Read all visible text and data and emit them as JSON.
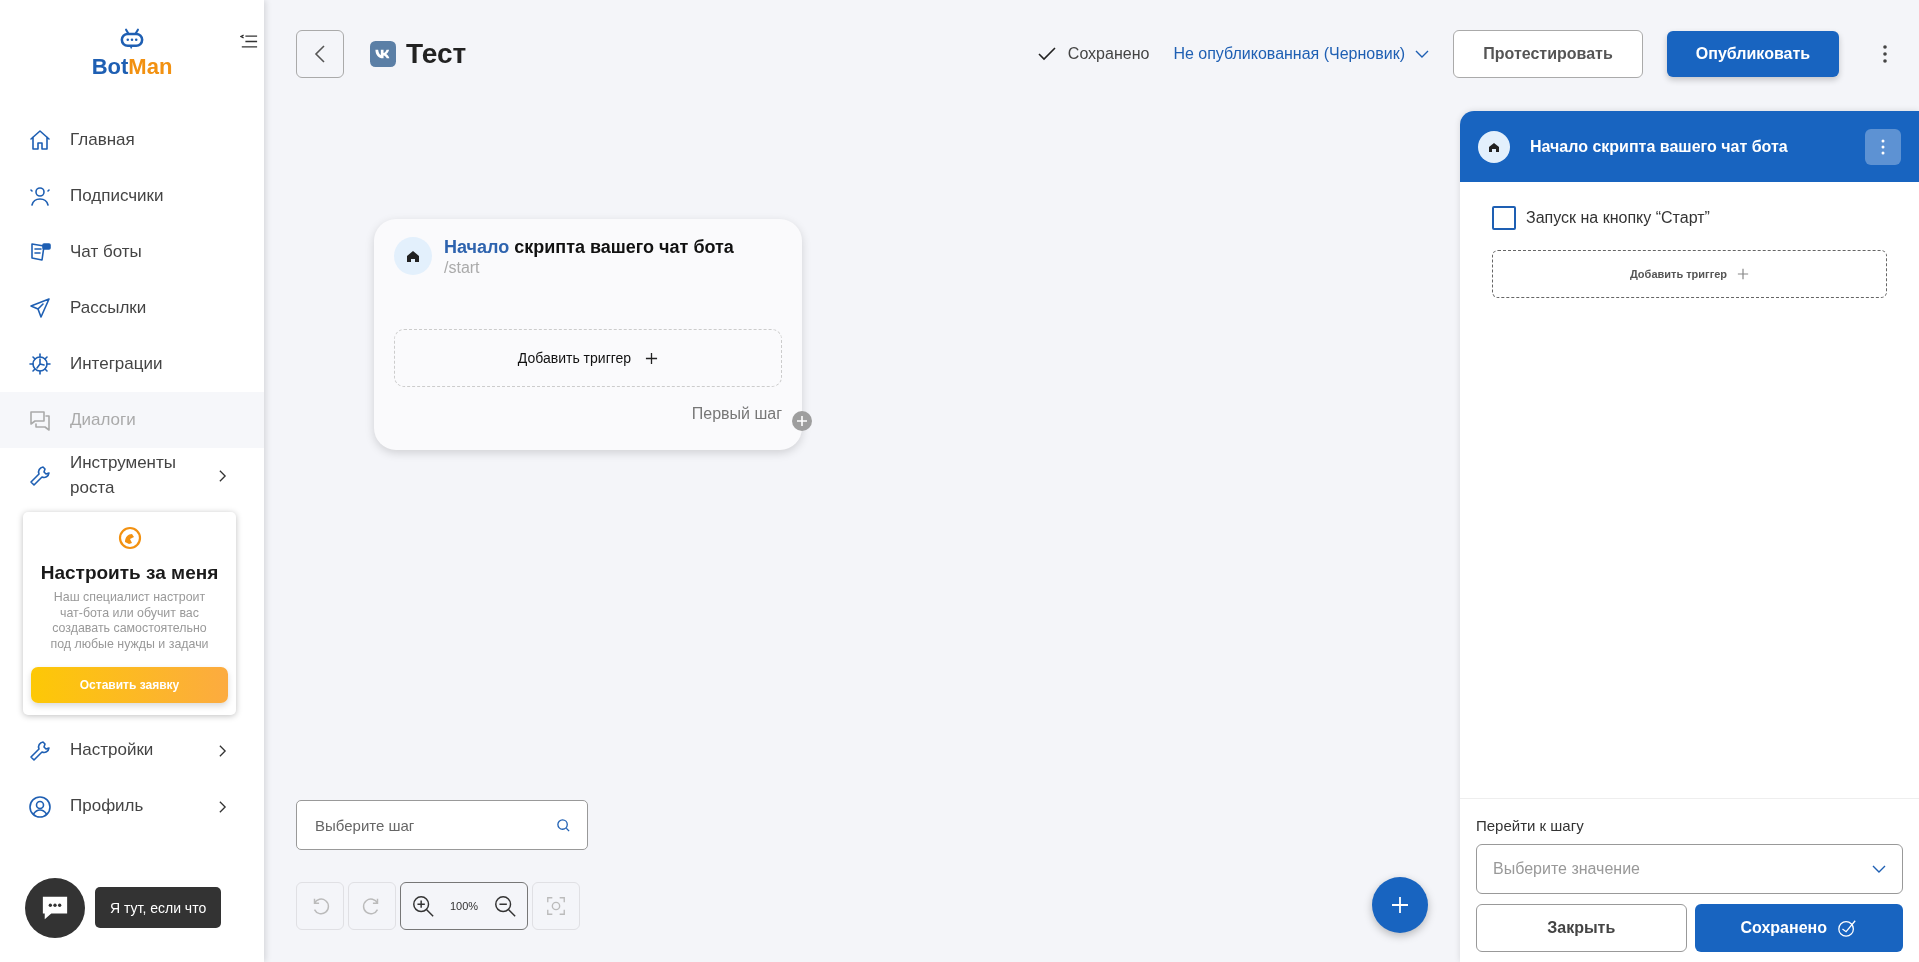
{
  "sidebar": {
    "logo": {
      "first": "Bot",
      "second": "Man"
    },
    "items": [
      {
        "label": "Главная",
        "disabled": false,
        "expandable": false
      },
      {
        "label": "Подписчики",
        "disabled": false,
        "expandable": false
      },
      {
        "label": "Чат боты",
        "disabled": false,
        "expandable": false
      },
      {
        "label": "Рассылки",
        "disabled": false,
        "expandable": false
      },
      {
        "label": "Интеграции",
        "disabled": false,
        "expandable": false
      },
      {
        "label": "Диалоги",
        "disabled": true,
        "expandable": false
      },
      {
        "label": "Инструменты роста",
        "disabled": false,
        "expandable": true
      }
    ],
    "promo": {
      "title": "Настроить за меня",
      "text": "Наш специалист настроит\nчат-бота или обучит вас\nсоздавать самостоятельно\nпод любые нужды и задачи",
      "button": "Оставить заявку"
    },
    "bottom_items": [
      {
        "label": "Настройки",
        "disabled": false,
        "expandable": true
      },
      {
        "label": "Профиль",
        "disabled": false,
        "expandable": true
      }
    ]
  },
  "header": {
    "title": "Тест",
    "save_status": "Сохранено",
    "publish_state": "Не опубликованная (Черновик)",
    "buttons": [
      "Протестировать",
      "Опубликовать"
    ]
  },
  "node": {
    "title_lead": "Начало",
    "title_rest": "скрипта вашего чат бота",
    "command": "/start",
    "add_trigger": "Добавить триггер",
    "next_step": "Первый шаг"
  },
  "step_search": {
    "placeholder": "Выберите шаг"
  },
  "zoom": {
    "value": "100%"
  },
  "panel": {
    "title": "Начало скрипта вашего чат бота",
    "checkbox": {
      "label": "Запуск на кнопку “Старт”",
      "checked": false
    },
    "add_trigger": "Добавить триггер",
    "goto_label": "Перейти к шагу",
    "goto_select": {
      "placeholder": "Выберите значение"
    },
    "buttons": [
      "Закрыть",
      "Сохранено"
    ]
  },
  "chat_widget": {
    "tooltip": "Я тут, если что"
  }
}
